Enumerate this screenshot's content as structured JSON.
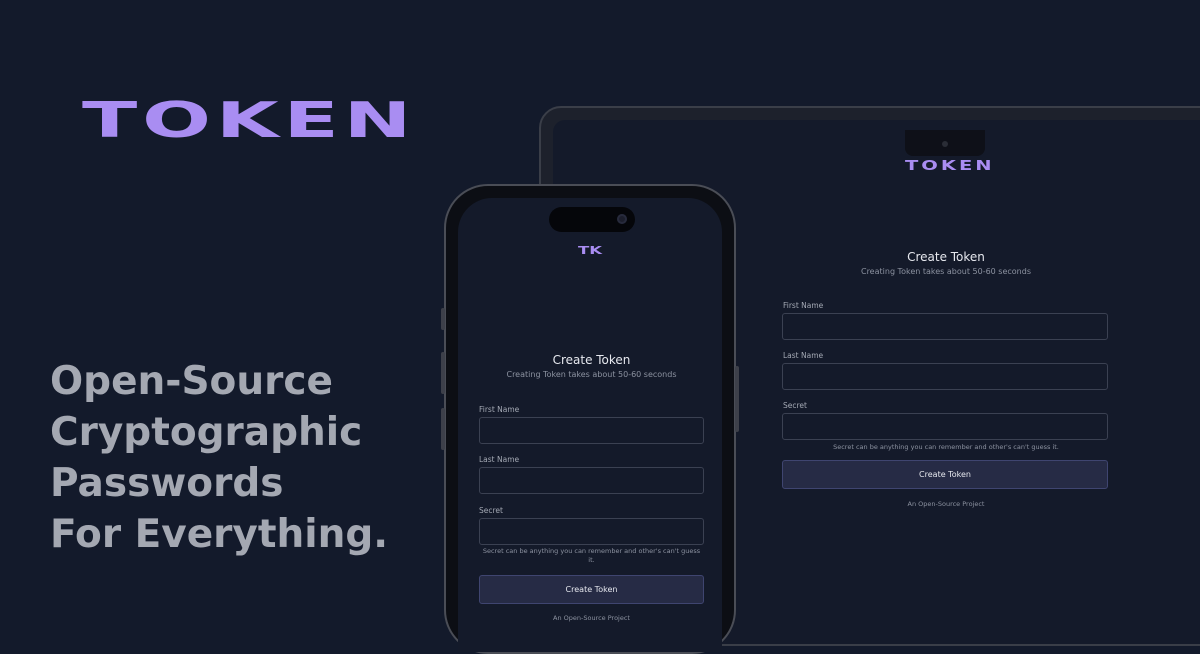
{
  "brand": {
    "wordmark": "TOKEN",
    "color": "#a98df2"
  },
  "headline": {
    "lines": [
      "Open-Source",
      "Cryptographic",
      "Passwords",
      "For Everything."
    ]
  },
  "laptop": {
    "logo": "TOKEN",
    "form": {
      "title": "Create Token",
      "subtitle": "Creating Token takes about 50-60 seconds",
      "first_name_label": "First Name",
      "last_name_label": "Last Name",
      "secret_label": "Secret",
      "secret_hint": "Secret can be anything you can remember and other's can't guess it.",
      "submit_label": "Create Token",
      "footer": "An Open-Source Project"
    }
  },
  "phone": {
    "logo": "TK",
    "form": {
      "title": "Create Token",
      "subtitle": "Creating Token takes about 50-60 seconds",
      "first_name_label": "First Name",
      "last_name_label": "Last Name",
      "secret_label": "Secret",
      "secret_hint": "Secret can be anything you can remember and other's can't guess it.",
      "submit_label": "Create Token",
      "footer": "An Open-Source Project"
    }
  }
}
